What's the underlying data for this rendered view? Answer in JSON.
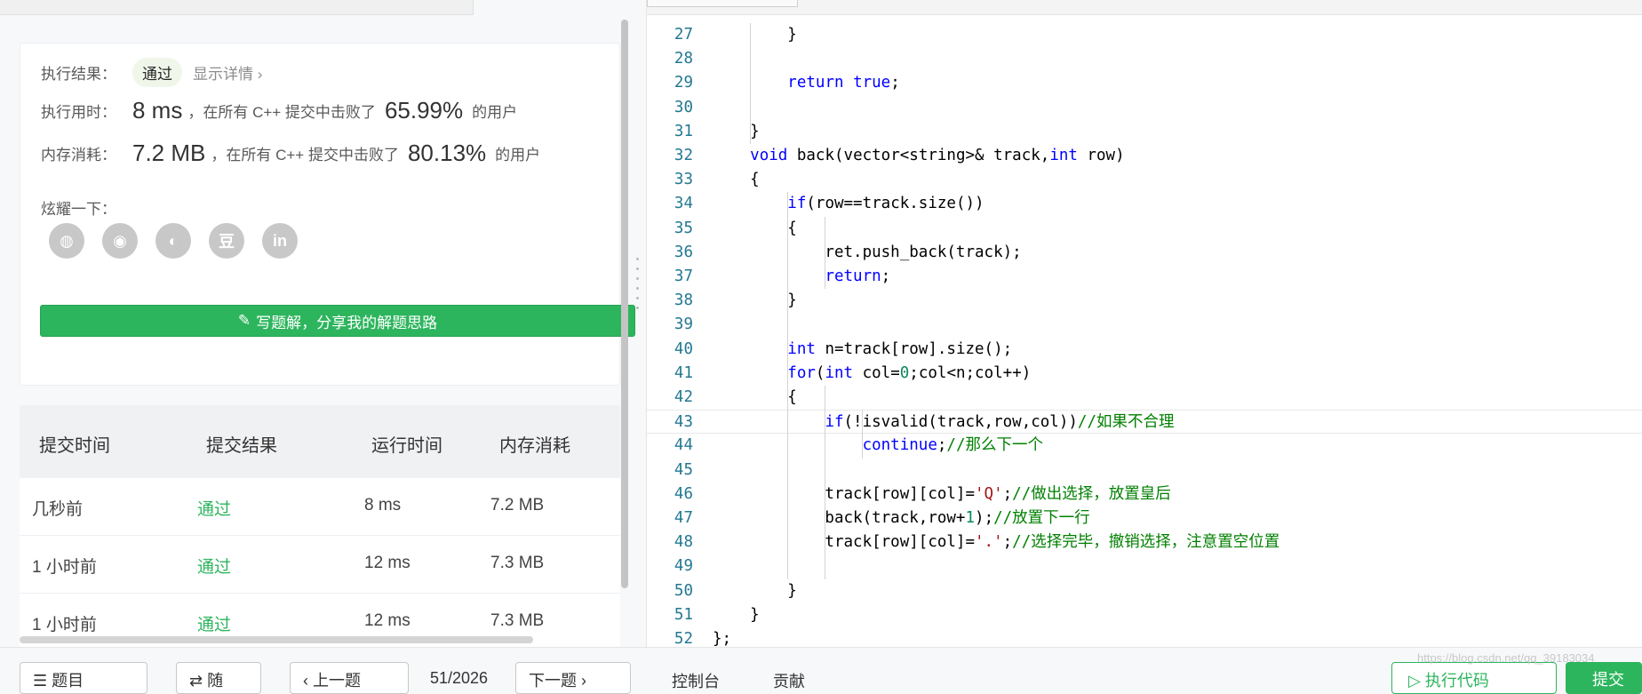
{
  "result": {
    "status_label": "执行结果：",
    "status_value": "通过",
    "detail_link": "显示详情",
    "detail_chevron": "›",
    "time_label": "执行用时：",
    "time_value": "8 ms",
    "time_text": "，在所有 C++ 提交中击败了",
    "time_pct": "65.99%",
    "time_suffix": "的用户",
    "mem_label": "内存消耗：",
    "mem_value": "7.2 MB",
    "mem_text": "，在所有 C++ 提交中击败了",
    "mem_pct": "80.13%",
    "mem_suffix": "的用户",
    "share_label": "炫耀一下：",
    "share_icons": [
      "wechat-icon",
      "weibo-icon",
      "qq-icon",
      "douban-icon",
      "linkedin-icon"
    ],
    "share_glyphs": [
      "◍",
      "◉",
      "◐",
      "豆",
      "in"
    ],
    "write_button": "写题解，分享我的解题思路",
    "write_icon": "✎"
  },
  "submissions": {
    "headers": [
      "提交时间",
      "提交结果",
      "运行时间",
      "内存消耗"
    ],
    "rows": [
      {
        "time": "几秒前",
        "result": "通过",
        "runtime": "8 ms",
        "memory": "7.2 MB"
      },
      {
        "time": "1 小时前",
        "result": "通过",
        "runtime": "12 ms",
        "memory": "7.3 MB"
      },
      {
        "time": "1 小时前",
        "result": "通过",
        "runtime": "12 ms",
        "memory": "7.3 MB"
      }
    ]
  },
  "editor": {
    "lines": [
      {
        "n": "27",
        "html": "        }"
      },
      {
        "n": "28",
        "html": ""
      },
      {
        "n": "29",
        "html": "        <span class=\"kw\">return</span> <span class=\"kw\">true</span>;"
      },
      {
        "n": "30",
        "html": ""
      },
      {
        "n": "31",
        "html": "    }"
      },
      {
        "n": "32",
        "html": "    <span class=\"kw\">void</span> back(vector&lt;string&gt;&amp; track,<span class=\"kw\">int</span> row)"
      },
      {
        "n": "33",
        "html": "    {"
      },
      {
        "n": "34",
        "html": "        <span class=\"kw\">if</span>(row==track.size())"
      },
      {
        "n": "35",
        "html": "        {"
      },
      {
        "n": "36",
        "html": "            ret.push_back(track);"
      },
      {
        "n": "37",
        "html": "            <span class=\"kw\">return</span>;"
      },
      {
        "n": "38",
        "html": "        }"
      },
      {
        "n": "39",
        "html": ""
      },
      {
        "n": "40",
        "html": "        <span class=\"kw\">int</span> n=track[row].size();"
      },
      {
        "n": "41",
        "html": "        <span class=\"kw\">for</span>(<span class=\"kw\">int</span> col=<span class=\"num\">0</span>;col&lt;n;col++)"
      },
      {
        "n": "42",
        "html": "        {"
      },
      {
        "n": "43",
        "html": "            <span class=\"kw\">if</span>(!isvalid(track,row,col))<span class=\"cmt\">//如果不合理</span>"
      },
      {
        "n": "44",
        "html": "                <span class=\"kw\">continue</span>;<span class=\"cmt\">//那么下一个</span>"
      },
      {
        "n": "45",
        "html": ""
      },
      {
        "n": "46",
        "html": "            track[row][col]=<span class=\"str\">'Q'</span>;<span class=\"cmt\">//做出选择，放置皇后</span>"
      },
      {
        "n": "47",
        "html": "            back(track,row+<span class=\"num\">1</span>);<span class=\"cmt\">//放置下一行</span>"
      },
      {
        "n": "48",
        "html": "            track[row][col]=<span class=\"str\">'.'</span>;<span class=\"cmt\">//选择完毕，撤销选择，注意置空位置</span>"
      },
      {
        "n": "49",
        "html": ""
      },
      {
        "n": "50",
        "html": "        }"
      },
      {
        "n": "51",
        "html": "    }"
      },
      {
        "n": "52",
        "html": "};"
      }
    ],
    "active_line": "43"
  },
  "bottom": {
    "list_button": "题目",
    "random_button": "随",
    "prev_button": "上一题",
    "page_counter": "51/2026",
    "next_button": "下一题",
    "console_label": "控制台",
    "contribute_label": "贡献",
    "run_button": "执行代码",
    "submit_button": "提交",
    "watermark": "https://blog.csdn.net/qq_39183034"
  }
}
